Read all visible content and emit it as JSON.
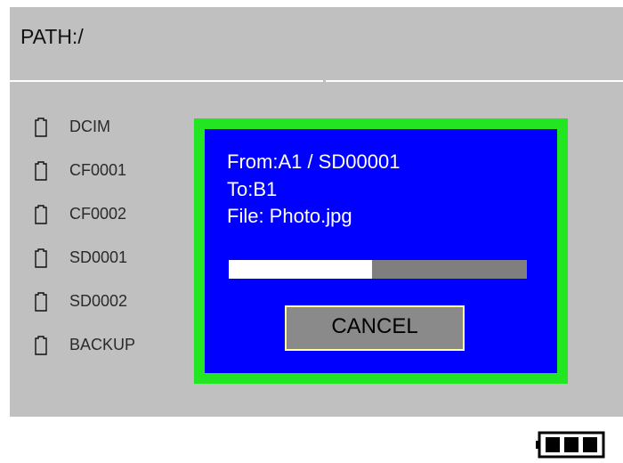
{
  "path": {
    "label": "PATH:/"
  },
  "file_list": {
    "items": [
      {
        "label": "DCIM",
        "icon": "card-icon"
      },
      {
        "label": "CF0001",
        "icon": "card-icon"
      },
      {
        "label": "CF0002",
        "icon": "card-icon"
      },
      {
        "label": "SD0001",
        "icon": "card-icon"
      },
      {
        "label": "SD0002",
        "icon": "card-icon"
      },
      {
        "label": "BACKUP",
        "icon": "card-icon"
      }
    ]
  },
  "dialog": {
    "from": {
      "key": "From ",
      "value": ":A1 / SD00001"
    },
    "to": {
      "key": "To ",
      "value": "    :B1"
    },
    "file": {
      "key": "File ",
      "value": "  : Photo.jpg"
    },
    "progress": 0.48,
    "cancel_label": "CANCEL"
  },
  "status": {
    "battery_icon": "battery-full-icon",
    "battery_level": 3,
    "battery_segments": 3
  },
  "colors": {
    "panel_background": "#c0c0c0",
    "dialog_background": "#0000ff",
    "dialog_border": "#22e622",
    "cancel_border": "#ffff99",
    "progress_track": "#7f7f7f",
    "progress_fill": "#ffffff",
    "battery": "#000000"
  }
}
